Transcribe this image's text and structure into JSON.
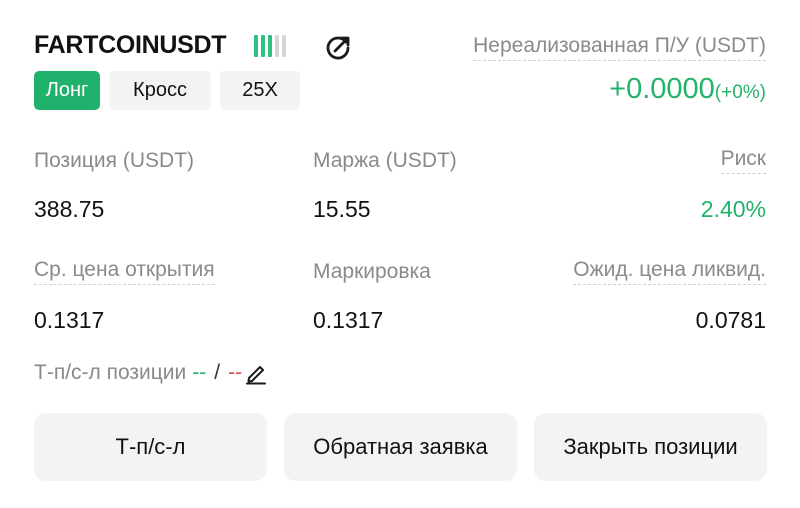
{
  "header": {
    "symbol": "FARTCOINUSDT",
    "leverage_bars": {
      "active": 3,
      "total": 5
    },
    "tags": {
      "side": "Лонг",
      "margin_mode": "Кросс",
      "leverage": "25X"
    },
    "share_icon": "share-rotate-icon"
  },
  "pnl": {
    "label": "Нереализованная П/У (USDT)",
    "value": "+0.0000",
    "percent": "(+0%)"
  },
  "stats": {
    "position": {
      "label": "Позиция (USDT)",
      "value": "388.75"
    },
    "margin": {
      "label": "Маржа (USDT)",
      "value": "15.55"
    },
    "risk": {
      "label": "Риск",
      "value": "2.40%"
    },
    "avg_open": {
      "label": "Ср. цена открытия",
      "value": "0.1317"
    },
    "mark": {
      "label": "Маркировка",
      "value": "0.1317"
    },
    "liq": {
      "label": "Ожид. цена ликвид.",
      "value": "0.0781"
    }
  },
  "tpsl": {
    "label": "Т-п/с-л позиции",
    "tp": "--",
    "separator": "/",
    "sl": "--",
    "edit_icon": "pencil-icon"
  },
  "buttons": {
    "tpsl": "Т-п/с-л",
    "reverse": "Обратная заявка",
    "close": "Закрыть позиции"
  },
  "colors": {
    "green": "#23b26a",
    "badge_green": "#20b26c",
    "red": "#e0484d",
    "bar_active": "#2ec27e",
    "bar_inactive": "#d6d6d6"
  }
}
